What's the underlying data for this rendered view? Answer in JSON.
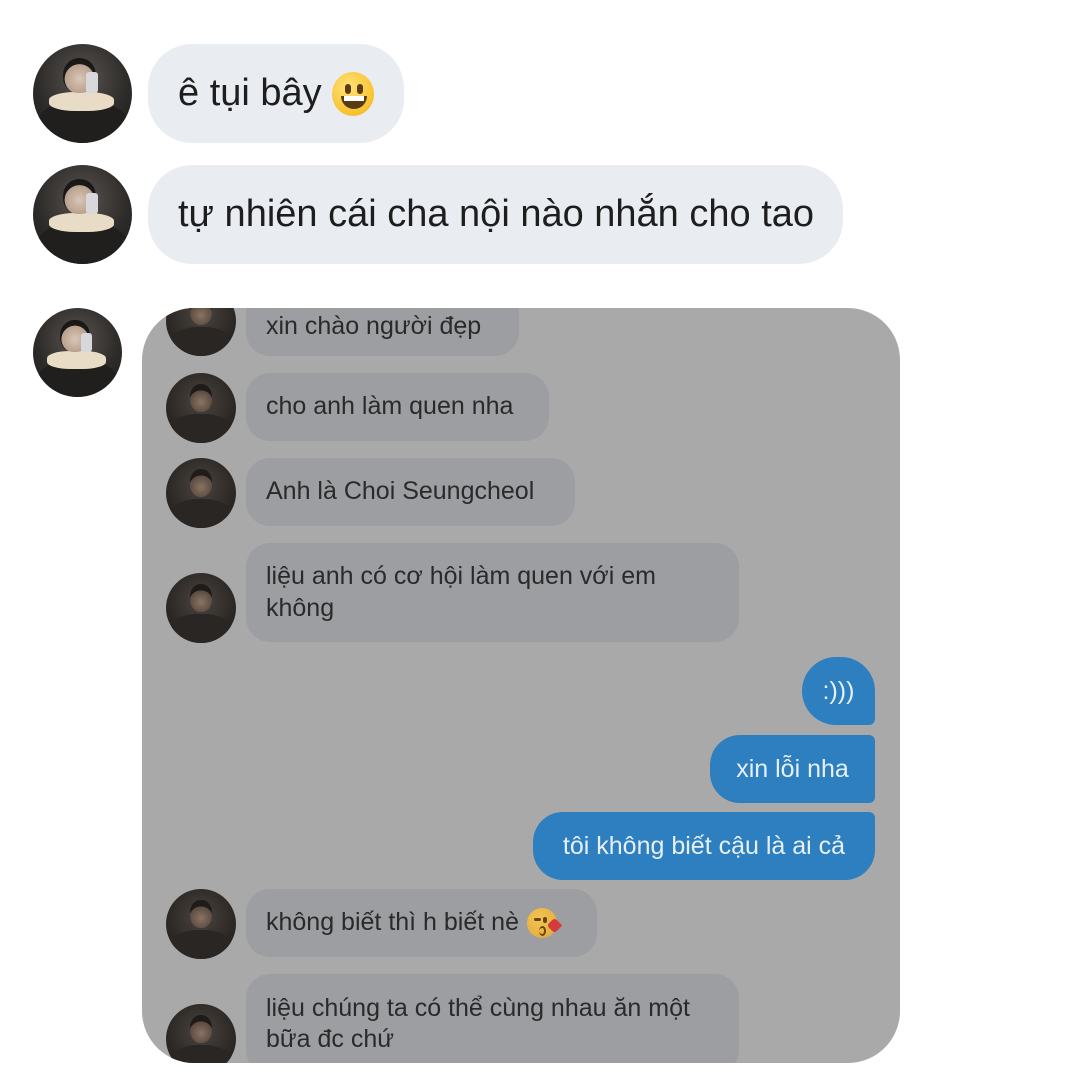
{
  "conversation": {
    "messages": [
      {
        "text": "ê tụi bây",
        "emoji": "grinning-face"
      },
      {
        "text": "tự nhiên cái cha nội nào nhắn cho tao"
      }
    ]
  },
  "screenshot": {
    "incoming": [
      {
        "text": "xin chào người đẹp"
      },
      {
        "text": "cho anh làm quen nha"
      },
      {
        "text": "Anh là Choi Seungcheol"
      },
      {
        "text": "liệu anh có cơ hội làm quen với em không"
      },
      {
        "text": "không biết thì h biết nè",
        "emoji": "face-blowing-kiss"
      },
      {
        "text": "liệu chúng ta có thể cùng nhau ăn một bữa đc chứ"
      }
    ],
    "outgoing": [
      {
        "text": ":)))"
      },
      {
        "text": "xin lỗi nha"
      },
      {
        "text": "tôi không biết cậu là ai cả"
      }
    ]
  },
  "colors": {
    "incoming_bubble": "#e9edf2",
    "screenshot_background": "#a9a9aa",
    "screenshot_incoming_bubble": "#9c9ea1",
    "screenshot_outgoing_bubble": "#2e7fbf"
  }
}
